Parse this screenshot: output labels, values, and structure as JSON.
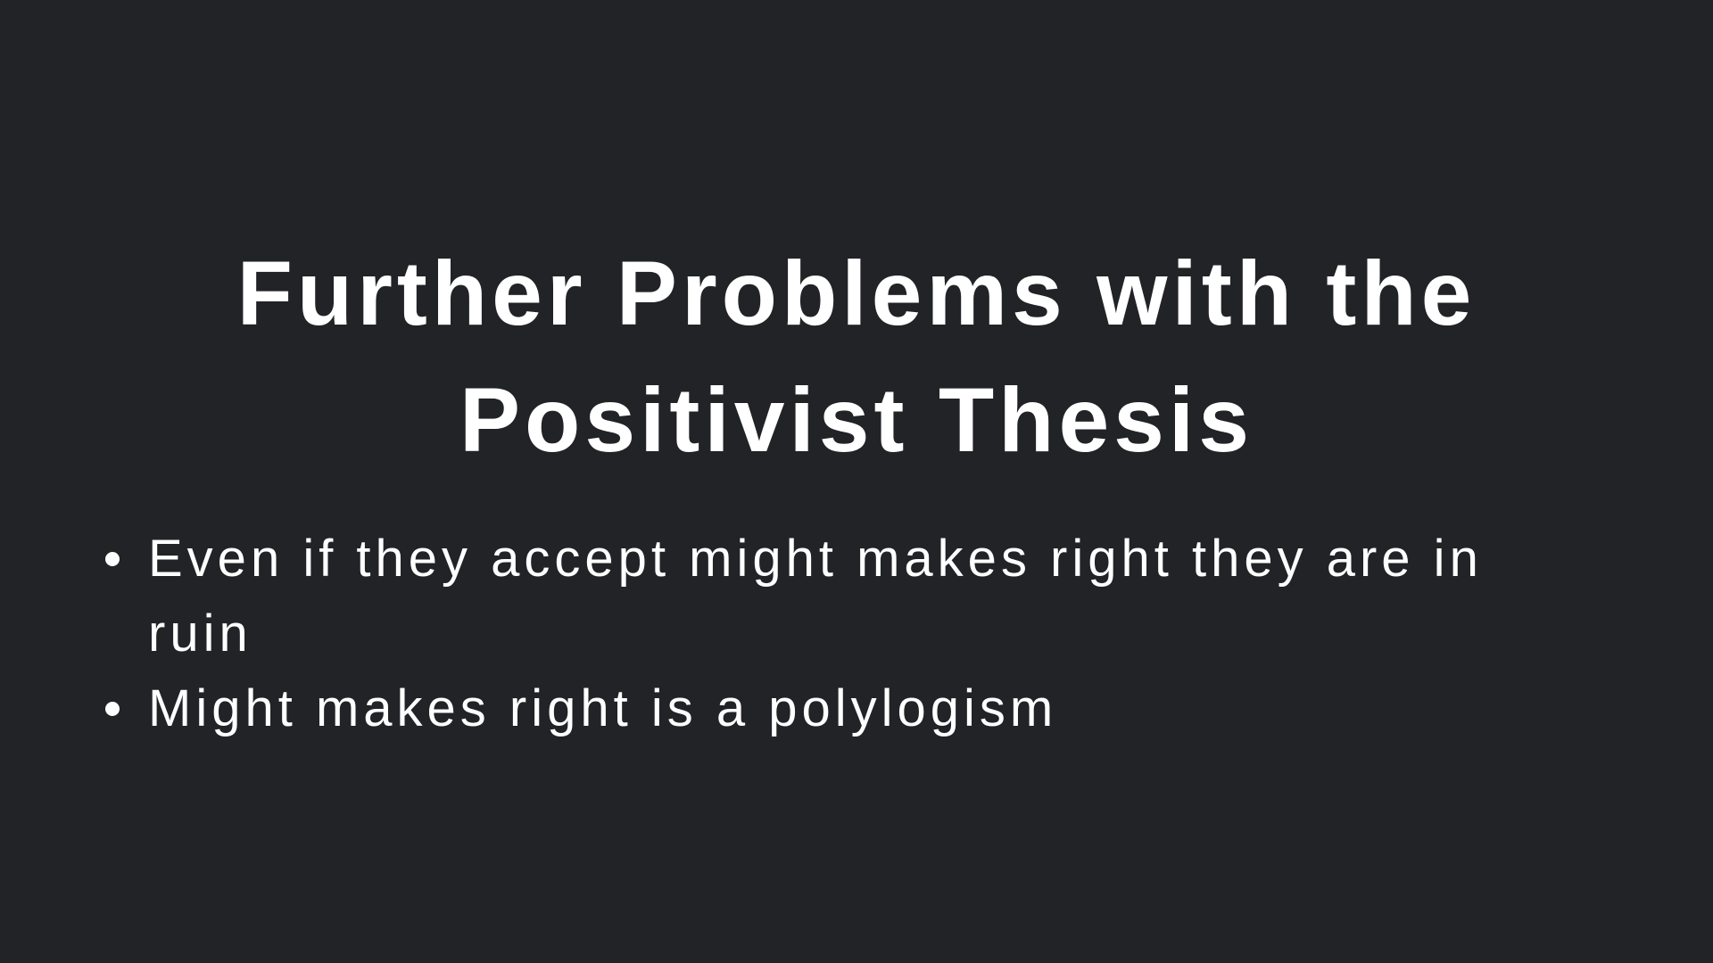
{
  "slide": {
    "title": "Further Problems with the Positivist Thesis",
    "bullets": [
      "Even if they accept might makes right they are in ruin",
      "Might makes right is a polylogism"
    ]
  },
  "colors": {
    "background": "#222327",
    "text": "#ffffff"
  }
}
